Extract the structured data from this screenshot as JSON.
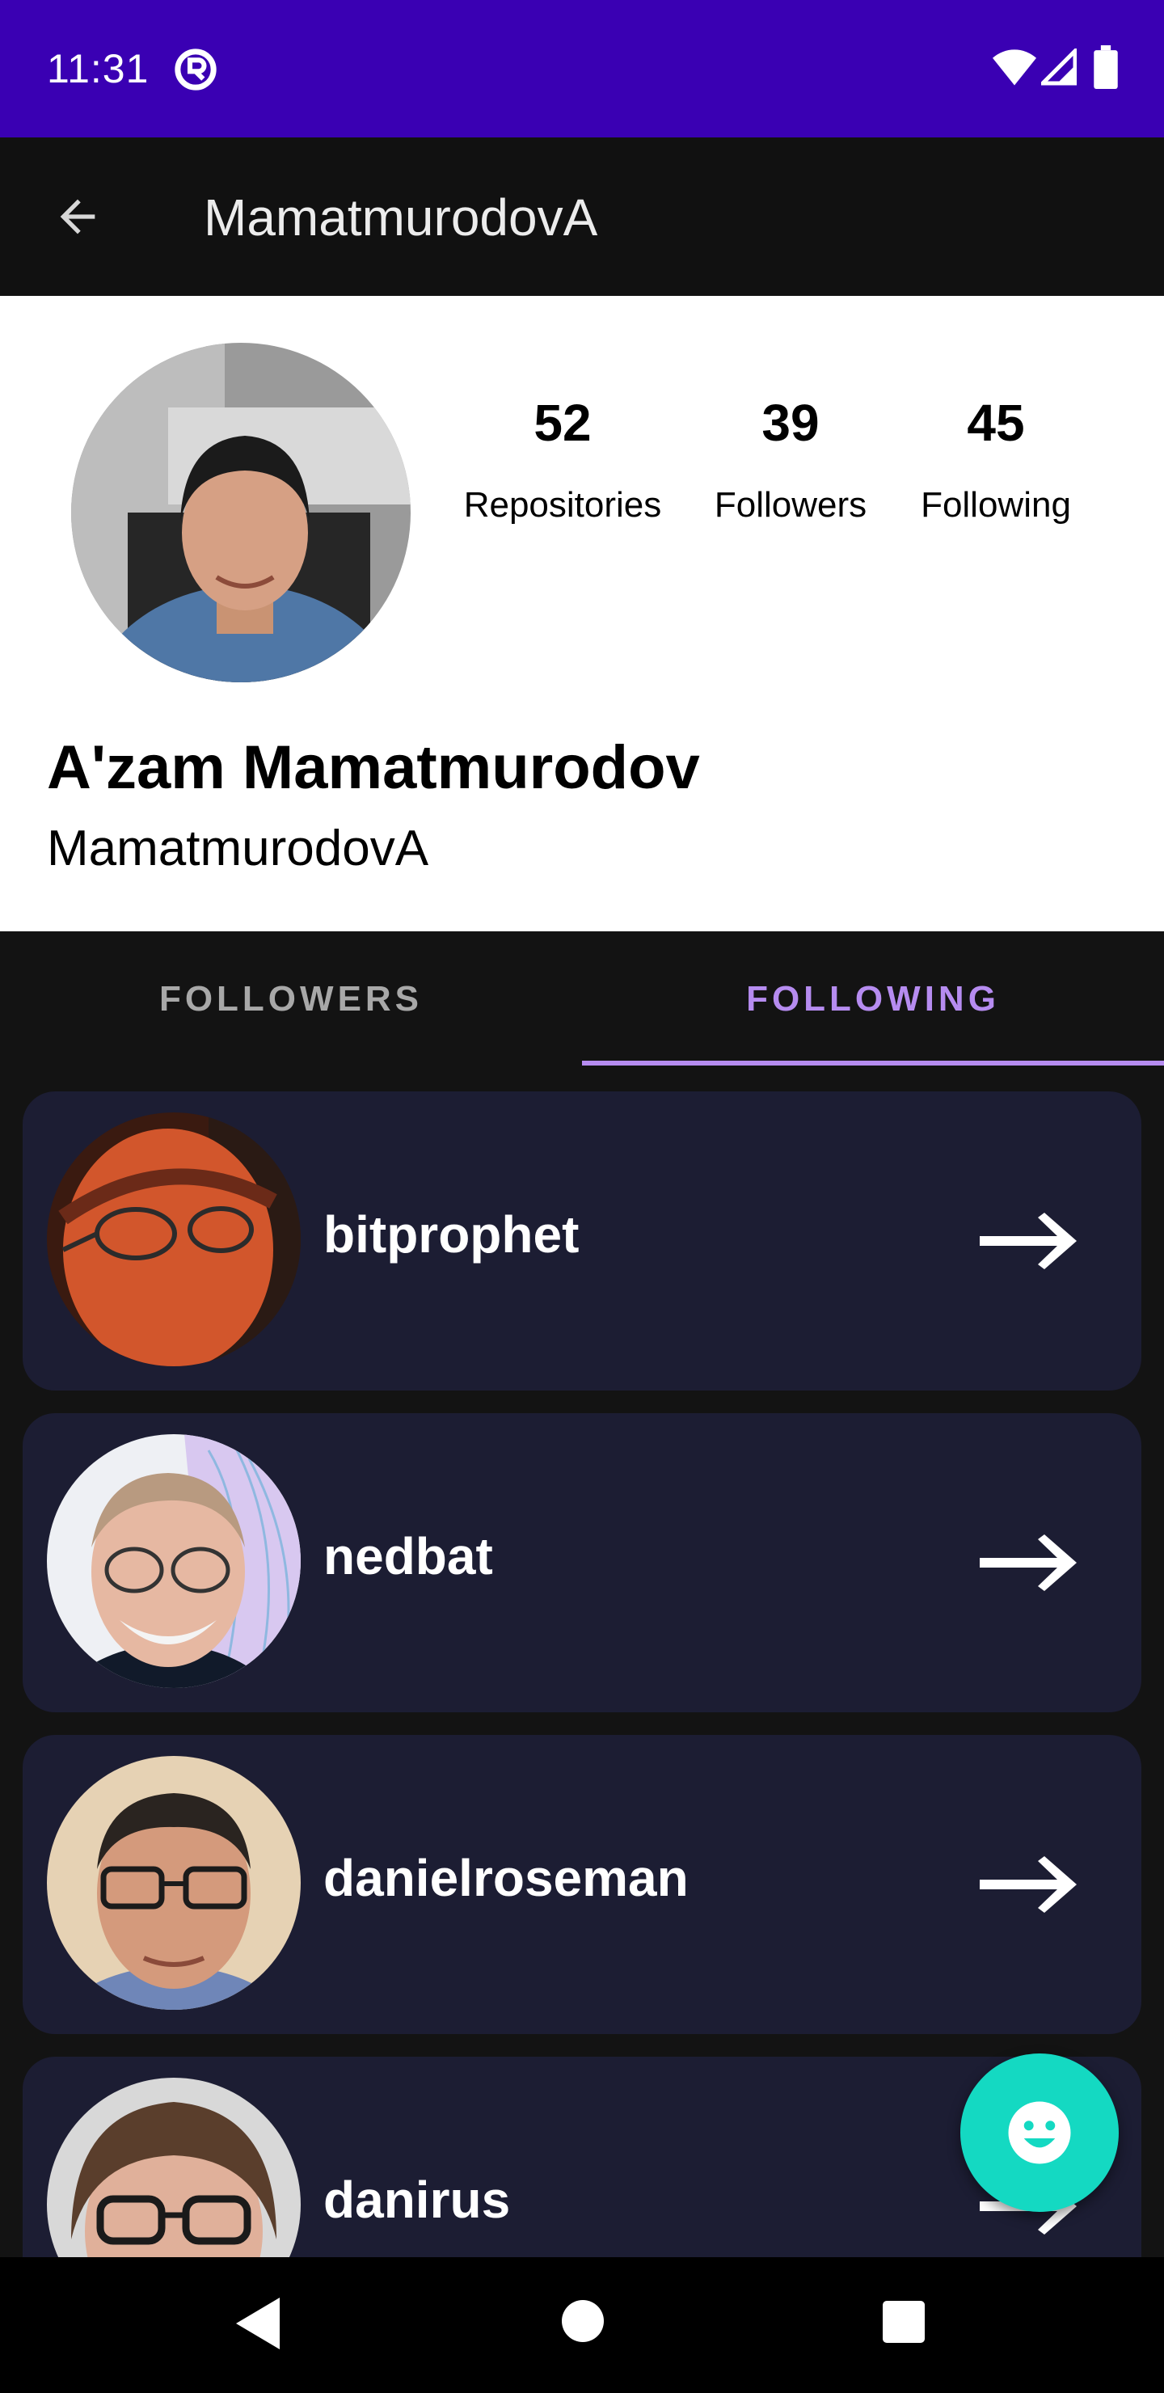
{
  "status_bar": {
    "time": "11:31"
  },
  "toolbar": {
    "title": "MamatmurodovA"
  },
  "profile": {
    "full_name": "A'zam Mamatmurodov",
    "username": "MamatmurodovA",
    "stats": [
      {
        "value": "52",
        "label": "Repositories"
      },
      {
        "value": "39",
        "label": "Followers"
      },
      {
        "value": "45",
        "label": "Following"
      }
    ]
  },
  "tabs": [
    {
      "label": "FOLLOWERS",
      "selected": false
    },
    {
      "label": "FOLLOWING",
      "selected": true
    }
  ],
  "following": [
    {
      "login": "bitprophet"
    },
    {
      "login": "nedbat"
    },
    {
      "login": "danielroseman"
    },
    {
      "login": "danirus"
    }
  ],
  "colors": {
    "status_bar": "#3a00b3",
    "accent": "#b68cf0",
    "card": "#1c1d33",
    "fab": "#14d9c2"
  }
}
